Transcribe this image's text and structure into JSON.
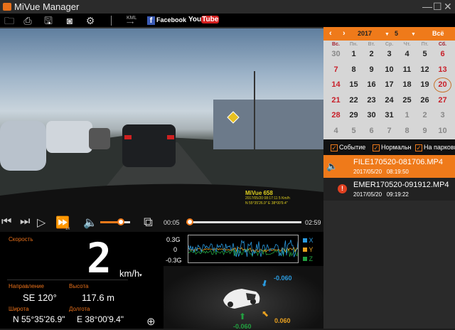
{
  "window": {
    "title": "MiVue Manager",
    "minimize": "—",
    "maximize": "☐",
    "close": "✕"
  },
  "toolbar": {
    "kml": "KML",
    "facebook": "Facebook",
    "youtube_you": "You",
    "youtube_tube": "Tube"
  },
  "video": {
    "overlay_brand": "MiVue 658",
    "overlay_line1": "2017/05/20 08:17:11 5 Km/h",
    "overlay_line2": "N 55°35'26.9\"  E  38°00'9.4\""
  },
  "player": {
    "speed": "1x",
    "current_time": "00:05",
    "total_time": "02:59",
    "volume_fraction": 0.7,
    "progress_fraction": 0.03
  },
  "telemetry": {
    "speed_label": "Скорость",
    "speed_value": "2",
    "speed_unit": "km/h",
    "direction_label": "Направление",
    "direction_value": "SE 120°",
    "altitude_label": "Высота",
    "altitude_value": "117.6  m",
    "latitude_label": "Широта",
    "latitude_value": "N 55°35'26.9\"",
    "longitude_label": "Долгота",
    "longitude_value": "E 38°00'9.4\""
  },
  "gsensor": {
    "y_top": "0.3G",
    "y_mid": "0",
    "y_bottom": "-0.3G",
    "legend": [
      {
        "name": "X",
        "color": "#2a9be0"
      },
      {
        "name": "Y",
        "color": "#e8a020"
      },
      {
        "name": "Z",
        "color": "#22a040"
      }
    ],
    "x_value": "-0.060",
    "y_value": "0.060",
    "z_value": "-0.060"
  },
  "calendar": {
    "year": "2017",
    "month": "5",
    "all": "Всё",
    "weekdays": [
      "Вс.",
      "Пн.",
      "Вт.",
      "Ср.",
      "Чт.",
      "Пт.",
      "Сб."
    ],
    "weeks": [
      [
        "30",
        "1",
        "2",
        "3",
        "4",
        "5",
        "6"
      ],
      [
        "7",
        "8",
        "9",
        "10",
        "11",
        "12",
        "13"
      ],
      [
        "14",
        "15",
        "16",
        "17",
        "18",
        "19",
        "20"
      ],
      [
        "21",
        "22",
        "23",
        "24",
        "25",
        "26",
        "27"
      ],
      [
        "28",
        "29",
        "30",
        "31",
        "1",
        "2",
        "3"
      ],
      [
        "4",
        "5",
        "6",
        "7",
        "8",
        "9",
        "10"
      ]
    ],
    "selected": "20"
  },
  "filters": {
    "event": "Событие",
    "normal": "Нормальн",
    "parking": "На парковк"
  },
  "files": [
    {
      "name": "FILE170520-081706.MP4",
      "date": "2017/05/20",
      "time": "08:19:50"
    },
    {
      "name": "EMER170520-091912.MP4",
      "date": "2017/05/20",
      "time": "09:19:22"
    }
  ],
  "accent": "#ef7a1a"
}
